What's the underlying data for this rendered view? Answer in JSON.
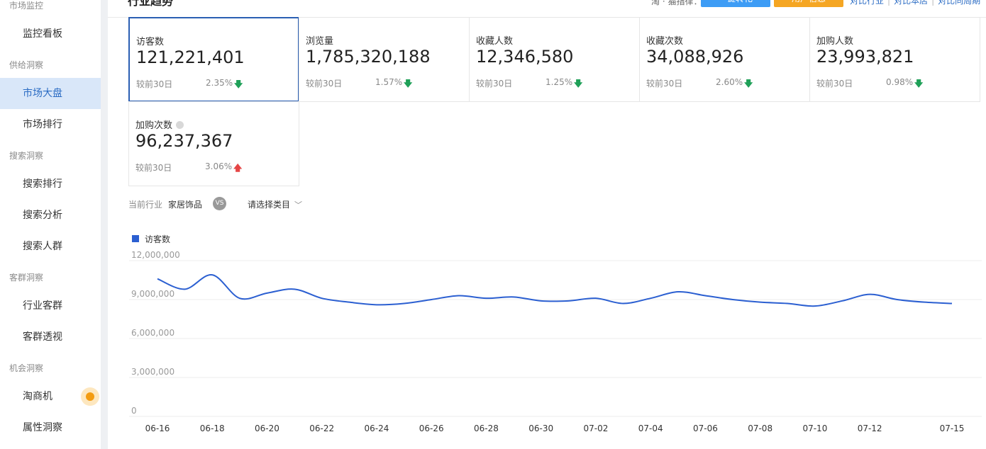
{
  "sidebar": {
    "sections": [
      {
        "label": "市场监控"
      },
      {
        "label": "供给洞察"
      },
      {
        "label": "搜索洞察"
      },
      {
        "label": "客群洞察"
      },
      {
        "label": "机会洞察"
      }
    ],
    "items": [
      {
        "label": "监控看板"
      },
      {
        "label": "市场大盘"
      },
      {
        "label": "市场排行"
      },
      {
        "label": "搜索排行"
      },
      {
        "label": "搜索分析"
      },
      {
        "label": "搜索人群"
      },
      {
        "label": "行业客群"
      },
      {
        "label": "客群透视"
      },
      {
        "label": "淘商机"
      },
      {
        "label": "属性洞察"
      }
    ],
    "active_color": "#d9e7f9"
  },
  "header": {
    "title": "行业趋势",
    "filter_label": "淘 · 猫指律：",
    "btn_blue": "一键转化",
    "btn_orange": "用户信息",
    "links": [
      "对比行业",
      "对比本店",
      "对比同周期"
    ]
  },
  "kpis": [
    {
      "label": "访客数",
      "value": "121,221,401",
      "compare": "较前30日",
      "pct": "2.35%",
      "trend": "down",
      "arrow": "🡇"
    },
    {
      "label": "浏览量",
      "value": "1,785,320,188",
      "compare": "较前30日",
      "pct": "1.57%",
      "trend": "down",
      "arrow": "🡇"
    },
    {
      "label": "收藏人数",
      "value": "12,346,580",
      "compare": "较前30日",
      "pct": "1.25%",
      "trend": "down",
      "arrow": "🡇"
    },
    {
      "label": "收藏次数",
      "value": "34,088,926",
      "compare": "较前30日",
      "pct": "2.60%",
      "trend": "down",
      "arrow": "🡇"
    },
    {
      "label": "加购人数",
      "value": "23,993,821",
      "compare": "较前30日",
      "pct": "0.98%",
      "trend": "down",
      "arrow": "🡇"
    },
    {
      "label": "加购次数",
      "value": "96,237,367",
      "compare": "较前30日",
      "pct": "3.06%",
      "trend": "up",
      "arrow": "🡅"
    }
  ],
  "compare": {
    "current_label": "当前行业",
    "industry": "家居饰品",
    "vs": "VS",
    "category_placeholder": "请选择类目",
    "chevron": "﹀"
  },
  "chart_data": {
    "type": "line",
    "series": [
      {
        "name": "访客数",
        "color": "#2b5fd1",
        "values": [
          10600000,
          9800000,
          10900000,
          9100000,
          9500000,
          9800000,
          9100000,
          8800000,
          8600000,
          8700000,
          9000000,
          9300000,
          9100000,
          9200000,
          8900000,
          8900000,
          9100000,
          8700000,
          9100000,
          9600000,
          9300000,
          9000000,
          8800000,
          8700000,
          8500000,
          8900000,
          9400000,
          9000000,
          8800000,
          8700000
        ]
      }
    ],
    "x": [
      "06-16",
      "06-17",
      "06-18",
      "06-19",
      "06-20",
      "06-21",
      "06-22",
      "06-23",
      "06-24",
      "06-25",
      "06-26",
      "06-27",
      "06-28",
      "06-29",
      "06-30",
      "07-01",
      "07-02",
      "07-03",
      "07-04",
      "07-05",
      "07-06",
      "07-07",
      "07-08",
      "07-09",
      "07-10",
      "07-11",
      "07-12",
      "07-13",
      "07-14",
      "07-15"
    ],
    "xtick_labels": [
      "06-16",
      "06-18",
      "06-20",
      "06-22",
      "06-24",
      "06-26",
      "06-28",
      "06-30",
      "07-02",
      "07-04",
      "07-06",
      "07-08",
      "07-10",
      "07-12",
      "07-15"
    ],
    "ytick_labels": [
      "12,000,000",
      "9,000,000",
      "6,000,000",
      "3,000,000",
      "0"
    ],
    "ylim": [
      0,
      12000000
    ],
    "legend": "top-left",
    "grid": true
  }
}
